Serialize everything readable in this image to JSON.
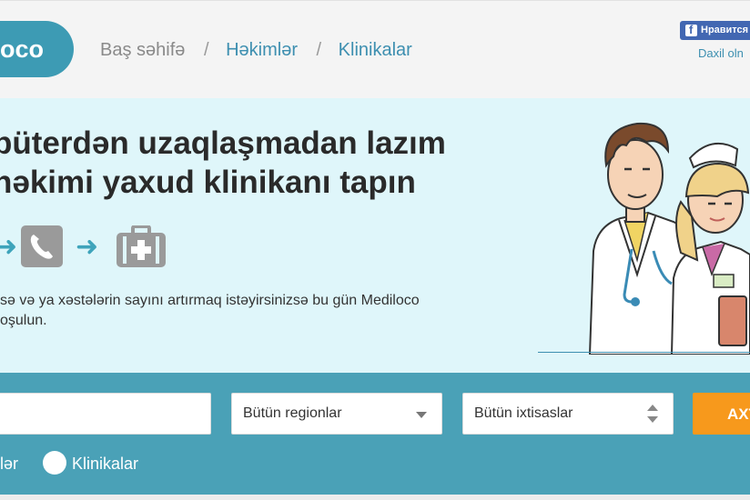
{
  "header": {
    "logo_text": "oco",
    "breadcrumb": {
      "home": "Baş səhifə",
      "separator": "/",
      "doctors": "Həkimlər",
      "clinics": "Klinikalar"
    },
    "facebook_button": "Нравится",
    "login_link": "Daxil oln"
  },
  "hero": {
    "title_line1": "püterdən uzaqlaşmadan lazım",
    "title_line2": "həkimi yaxud klinikanı tapın",
    "steps": [
      "arrow-right-icon",
      "phone-icon",
      "arrow-right-icon",
      "medical-kit-icon"
    ],
    "text_line1": "sə və ya xəstələrin sayını artırmaq istəyirsinizsə bu gün Mediloco",
    "text_line2": "oşulun."
  },
  "search": {
    "query_value": "",
    "region_select": "Bütün regionlar",
    "specialty_select": "Bütün ixtisaslar",
    "button_label": "AXT",
    "radio_doctors": "lər",
    "radio_clinics": "Klinikalar"
  },
  "colors": {
    "brand_teal": "#3d9bb4",
    "hero_bg": "#dff6fa",
    "search_bg": "#4aa1b7",
    "search_button": "#f7991c",
    "link": "#3d8fb0"
  }
}
